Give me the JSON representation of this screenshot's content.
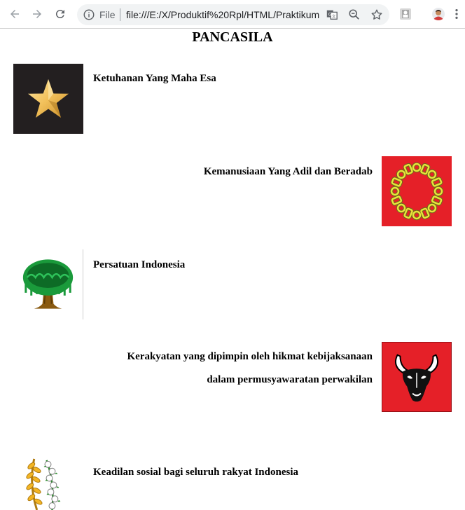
{
  "browser": {
    "back_icon": "arrow-left-icon",
    "forward_icon": "arrow-right-icon",
    "reload_icon": "reload-icon",
    "scheme_label": "File",
    "url": "file:///E:/X/Produktif%20Rpl/HTML/Praktikum",
    "translate_icon": "translate-icon",
    "zoom_icon": "magnifier-minus-icon",
    "star_icon": "star-outline-icon",
    "menu_icon": "kebab-menu-icon"
  },
  "page": {
    "title": "PANCASILA",
    "sila": [
      {
        "text": "Ketuhanan Yang Maha Esa",
        "icon": "gold-star-icon"
      },
      {
        "text": "Kemanusiaan Yang Adil dan Beradab",
        "icon": "chain-icon"
      },
      {
        "text": "Persatuan Indonesia",
        "icon": "banyan-tree-icon"
      },
      {
        "text_line1": "Kerakyatan yang dipimpin oleh hikmat kebijaksanaan",
        "text_line2": "dalam permusyawaratan perwakilan",
        "icon": "bull-head-icon"
      },
      {
        "text": "Keadilan sosial bagi seluruh rakyat Indonesia",
        "icon": "rice-cotton-icon"
      }
    ]
  }
}
